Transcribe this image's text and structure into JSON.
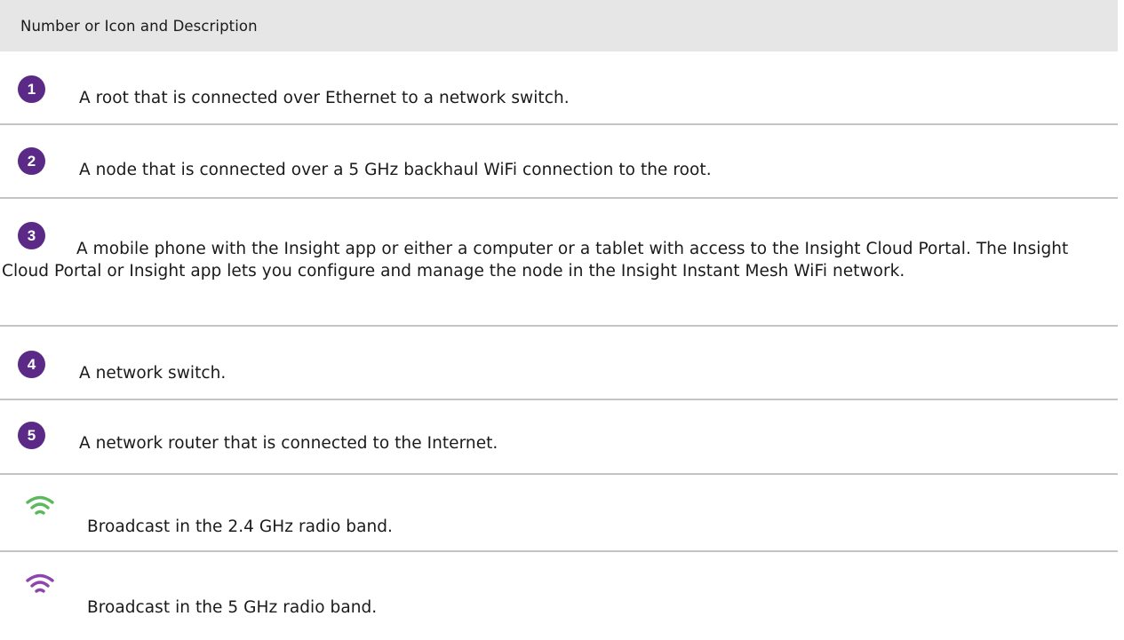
{
  "header": {
    "title": "Number or Icon and Description"
  },
  "rows": [
    {
      "badge": "1",
      "text": "A root that is connected over Ethernet to a network switch."
    },
    {
      "badge": "2",
      "text": "A node that is connected over a 5 GHz backhaul WiFi connection to the root."
    },
    {
      "badge": "3",
      "text": "A mobile phone with the Insight app or either a computer or a tablet with access to the Insight Cloud Portal. The Insight Cloud Portal or Insight app lets you configure and manage the node in the Insight Instant Mesh WiFi network."
    },
    {
      "badge": "4",
      "text": "A network switch."
    },
    {
      "badge": "5",
      "text": "A network router that is connected to the Internet."
    },
    {
      "icon": "wifi-green-icon",
      "color": "#5cb85c",
      "text": "Broadcast in the 2.4 GHz radio band."
    },
    {
      "icon": "wifi-purple-icon",
      "color": "#8e44ad",
      "text": "Broadcast in the 5 GHz radio band."
    }
  ]
}
